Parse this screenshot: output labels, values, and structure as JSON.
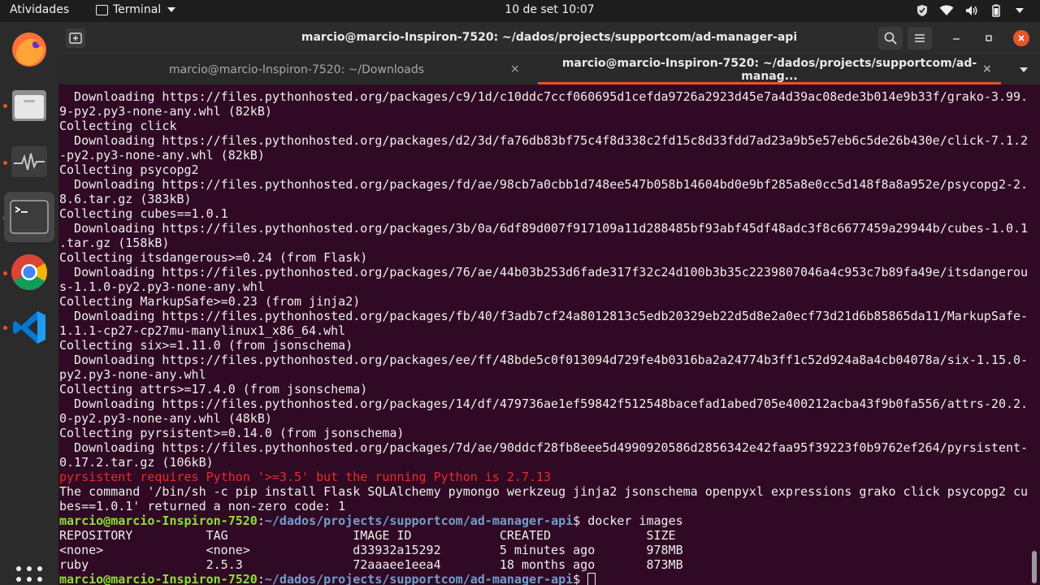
{
  "topbar": {
    "activities": "Atividades",
    "app_name": "Terminal",
    "clock": "10 de set  10:07"
  },
  "dock": {
    "items": [
      {
        "name": "Firefox",
        "icon": "firefox-icon"
      },
      {
        "name": "Files",
        "icon": "files-icon"
      },
      {
        "name": "System Monitor",
        "icon": "system-monitor-icon"
      },
      {
        "name": "Terminal",
        "icon": "terminal-icon"
      },
      {
        "name": "Google Chrome",
        "icon": "chrome-icon"
      },
      {
        "name": "Visual Studio Code",
        "icon": "vscode-icon"
      }
    ]
  },
  "window": {
    "title": "marcio@marcio-Inspiron-7520: ~/dados/projects/supportcom/ad-manager-api",
    "tabs": [
      {
        "label": "marcio@marcio-Inspiron-7520: ~/Downloads",
        "close": "×"
      },
      {
        "label": "marcio@marcio-Inspiron-7520: ~/dados/projects/supportcom/ad-manag...",
        "close": "×"
      }
    ]
  },
  "terminal": {
    "lines": [
      "  Downloading https://files.pythonhosted.org/packages/c9/1d/c10ddc7ccf060695d1cefda9726a2923d45e7a4d39ac08ede3b014e9b33f/grako-3.99.",
      "9-py2.py3-none-any.whl (82kB)",
      "Collecting click",
      "  Downloading https://files.pythonhosted.org/packages/d2/3d/fa76db83bf75c4f8d338c2fd15c8d33fdd7ad23a9b5e57eb6c5de26b430e/click-7.1.2",
      "-py2.py3-none-any.whl (82kB)",
      "Collecting psycopg2",
      "  Downloading https://files.pythonhosted.org/packages/fd/ae/98cb7a0cbb1d748ee547b058b14604bd0e9bf285a8e0cc5d148f8a8a952e/psycopg2-2.",
      "8.6.tar.gz (383kB)",
      "Collecting cubes==1.0.1",
      "  Downloading https://files.pythonhosted.org/packages/3b/0a/6df89d007f917109a11d288485bf93abf45df48adc3f8c6677459a29944b/cubes-1.0.1",
      ".tar.gz (158kB)",
      "Collecting itsdangerous>=0.24 (from Flask)",
      "  Downloading https://files.pythonhosted.org/packages/76/ae/44b03b253d6fade317f32c24d100b3b35c2239807046a4c953c7b89fa49e/itsdangerous",
      "s-1.1.0-py2.py3-none-any.whl",
      "Collecting MarkupSafe>=0.23 (from jinja2)",
      "  Downloading https://files.pythonhosted.org/packages/fb/40/f3adb7cf24a8012813c5edb20329eb22d5d8e2a0ecf73d21d6b85865da11/MarkupSafe-",
      "1.1.1-cp27-cp27mu-manylinux1_x86_64.whl",
      "Collecting six>=1.11.0 (from jsonschema)",
      "  Downloading https://files.pythonhosted.org/packages/ee/ff/48bde5c0f013094d729fe4b0316ba2a24774b3ff1c52d924a8a4cb04078a/six-1.15.0-",
      "py2.py3-none-any.whl",
      "Collecting attrs>=17.4.0 (from jsonschema)",
      "  Downloading https://files.pythonhosted.org/packages/14/df/479736ae1ef59842f512548bacefad1abed705e400212acba43f9b0fa556/attrs-20.2.",
      "0-py2.py3-none-any.whl (48kB)",
      "Collecting pyrsistent>=0.14.0 (from jsonschema)",
      "  Downloading https://files.pythonhosted.org/packages/7d/ae/90ddcf28fb8eee5d4990920586d2856342e42faa95f39223f0b9762ef264/pyrsistent-",
      "0.17.2.tar.gz (106kB)"
    ],
    "error_line": "pyrsistent requires Python '>=3.5' but the running Python is 2.7.13",
    "command_failed_lines": [
      "The command '/bin/sh -c pip install Flask SQLAlchemy pymongo werkzeug jinja2 jsonschema openpyxl expressions grako click psycopg2 cu",
      "bes==1.0.1' returned a non-zero code: 1"
    ],
    "prompt_user": "marcio@marcio-Inspiron-7520",
    "prompt_sep": ":",
    "prompt_path": "~/dados/projects/supportcom/ad-manager-api",
    "prompt_symbol": "$ ",
    "command": "docker images",
    "docker_table": [
      "REPOSITORY          TAG                 IMAGE ID            CREATED             SIZE",
      "<none>              <none>              d33932a15292        5 minutes ago       978MB",
      "ruby                2.5.3               72aaaee1eea4        18 months ago       873MB"
    ]
  }
}
